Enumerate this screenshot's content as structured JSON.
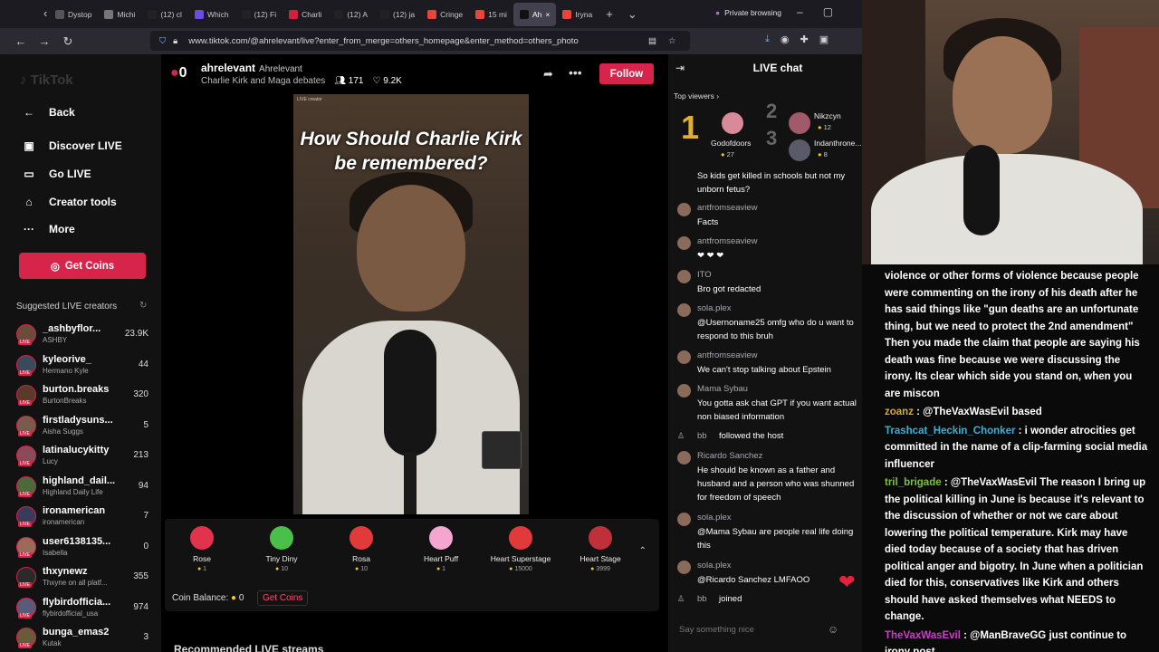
{
  "browser": {
    "tabs": [
      {
        "label": "Dystop",
        "color": "#555"
      },
      {
        "label": "Michi",
        "color": "#777"
      },
      {
        "label": "(12) cl",
        "color": "#222"
      },
      {
        "label": "Which",
        "color": "#6a4ce0"
      },
      {
        "label": "(12) Fi",
        "color": "#222"
      },
      {
        "label": "Charli",
        "color": "#d1203a"
      },
      {
        "label": "(12) A",
        "color": "#222"
      },
      {
        "label": "(12) ja",
        "color": "#222"
      },
      {
        "label": "Cringe",
        "color": "#e8443a"
      },
      {
        "label": "15 mi",
        "color": "#e8443a"
      },
      {
        "label": "Ah",
        "color": "#111",
        "active": true
      },
      {
        "label": "Iryna",
        "color": "#e8443a"
      }
    ],
    "private_label": "Private browsing",
    "url": "www.tiktok.com/@ahrelevant/live?enter_from_merge=others_homepage&enter_method=others_photo"
  },
  "sidebar": {
    "logo": "TikTok",
    "menu": [
      {
        "label": "Back",
        "icon": "arrow-left-icon",
        "glyph": "←"
      },
      {
        "label": "Discover LIVE",
        "icon": "tv-icon",
        "glyph": "▣"
      },
      {
        "label": "Go LIVE",
        "icon": "camera-icon",
        "glyph": "▭"
      },
      {
        "label": "Creator tools",
        "icon": "home-icon",
        "glyph": "⌂"
      },
      {
        "label": "More",
        "icon": "more-icon",
        "glyph": "···"
      }
    ],
    "get_coins": "Get Coins",
    "suggested_title": "Suggested LIVE creators",
    "creators": [
      {
        "name": "_ashbyflor...",
        "sub": "ASHBY",
        "count": "23.9K",
        "color": "#6b4b3a"
      },
      {
        "name": "kyleorive_",
        "sub": "Hermano Kyle",
        "count": "44",
        "color": "#3a4a5a"
      },
      {
        "name": "burton.breaks",
        "sub": "BurtonBreaks",
        "count": "320",
        "color": "#5a3a2a"
      },
      {
        "name": "firstladysuns...",
        "sub": "Aisha Suggs",
        "count": "5",
        "color": "#7a5a4a"
      },
      {
        "name": "latinalucykitty",
        "sub": "Lucy",
        "count": "213",
        "color": "#8a4a5a"
      },
      {
        "name": "highland_dail...",
        "sub": "Highland Daily Life",
        "count": "94",
        "color": "#4a6a3a"
      },
      {
        "name": "ironamerican",
        "sub": "ironamerican",
        "count": "7",
        "color": "#3a3a5a"
      },
      {
        "name": "user6138135...",
        "sub": "Isabella",
        "count": "0",
        "color": "#9a6a5a"
      },
      {
        "name": "thxynewz",
        "sub": "Thxyne on all platf...",
        "count": "355",
        "color": "#2a2a2a"
      },
      {
        "name": "flybirdofficia...",
        "sub": "flybirdofficial_usa",
        "count": "974",
        "color": "#5a5a7a"
      },
      {
        "name": "bunga_emas2",
        "sub": "Kutak",
        "count": "3",
        "color": "#6a5a3a"
      }
    ]
  },
  "header": {
    "avatar_text": "0",
    "name": "ahrelevant",
    "handle": "Ahrelevant",
    "subtitle": "Charlie Kirk and Maga debates",
    "viewers": "171",
    "likes": "9.2K",
    "follow": "Follow"
  },
  "video": {
    "title": "How Should Charlie Kirk be remembered?",
    "label": "LIVE creator"
  },
  "gifts": {
    "items": [
      {
        "name": "Rose",
        "price": "1",
        "color": "#e2334d"
      },
      {
        "name": "Tiny Diny",
        "price": "10",
        "color": "#4ac04a"
      },
      {
        "name": "Rosa",
        "price": "10",
        "color": "#e23a3a"
      },
      {
        "name": "Heart Puff",
        "price": "1",
        "color": "#f3a6d0"
      },
      {
        "name": "Heart Superstage",
        "price": "15000",
        "color": "#e23a3a"
      },
      {
        "name": "Heart Stage",
        "price": "3999",
        "color": "#c0303a"
      }
    ],
    "coin_balance_label": "Coin Balance:",
    "coin_balance": "0",
    "get_coins": "Get Coins"
  },
  "recommended": "Recommended LIVE streams",
  "chat": {
    "title": "LIVE chat",
    "top_viewers_label": "Top viewers",
    "top_viewers": [
      {
        "rank": "1",
        "name": "Godofdoors",
        "count": "27"
      },
      {
        "rank": "2",
        "name": "Nikzcyn",
        "count": "12"
      },
      {
        "rank": "3",
        "name": "Indanthrone...",
        "count": "8"
      }
    ],
    "messages": [
      {
        "user": "",
        "text": "So kids get killed in schools but not my unborn fetus?"
      },
      {
        "user": "antfromseaview",
        "text": "Facts"
      },
      {
        "user": "antfromseaview",
        "text": "❤ ❤ ❤"
      },
      {
        "user": "ITO",
        "text": "Bro got redacted"
      },
      {
        "user": "sola.plex",
        "text": "@Usernoname25 omfg who do u want to respond to this bruh"
      },
      {
        "user": "antfromseaview",
        "text": "We can't stop talking about Epstein"
      },
      {
        "user": "Mama Sybau",
        "text": "You gotta ask chat GPT if you want actual non biased information"
      },
      {
        "user": "bb",
        "text": "followed the host"
      },
      {
        "user": "Ricardo Sanchez",
        "text": "He should be known as a father and husband and a person who was shunned for freedom of speech"
      },
      {
        "user": "sola.plex",
        "text": "@Mama Sybau are people real life doing this"
      },
      {
        "user": "sola.plex",
        "text": "@Ricardo Sanchez LMFAOO"
      },
      {
        "user": "bb",
        "text": "joined"
      }
    ],
    "input_placeholder": "Say something nice"
  },
  "twitch_chat": [
    {
      "user": "",
      "color": "#ffffff",
      "text": "violence or other forms of violence because people were commenting on the irony of his death after he has said things like \"gun deaths are an unfortunate thing, but we need to protect the 2nd amendment\" Then you made the claim that people are saying his death was fine because we were discussing the irony. Its clear which side you stand on, when you are miscon"
    },
    {
      "user": "zoanz",
      "color": "#d2a93a",
      "text": ": @TheVaxWasEvil based"
    },
    {
      "user": "Trashcat_Heckin_Chonker",
      "color": "#3ab0d8",
      "text": ": i wonder atrocities get committed in the name of a clip-farming social media influencer"
    },
    {
      "user": "tril_brigade",
      "color": "#7ac043",
      "text": ": @TheVaxWasEvil The reason I bring up the political killing in June is because it's relevant to the discussion of whether or not we care about lowering the political temperature. Kirk may have died today because of a society that has driven political anger and bigotry. In June when a politician died for this, conservatives like Kirk and others should have asked themselves what NEEDS to change."
    },
    {
      "user": "TheVaxWasEvil",
      "color": "#d43ad0",
      "text": ": @ManBraveGG just continue to irony post"
    }
  ]
}
